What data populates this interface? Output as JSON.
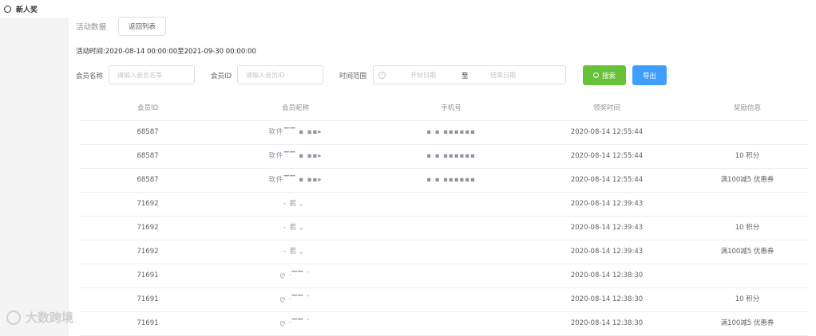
{
  "sidebar": {
    "items": [
      {
        "label": "新人奖"
      }
    ]
  },
  "header": {
    "title": "活动数据",
    "back_label": "返回列表",
    "activity_time": "活动时间:2020-08-14 00:00:00至2021-09-30 00:00:00"
  },
  "filters": {
    "member_name_label": "会员名称",
    "member_name_placeholder": "请输入会员名等",
    "member_id_label": "会员ID",
    "member_id_placeholder": "请输入会员ID",
    "time_range_label": "时间范围",
    "start_placeholder": "开始日期",
    "range_separator": "至",
    "end_placeholder": "结束日期",
    "search_label": "搜索",
    "export_label": "导出"
  },
  "table": {
    "columns": [
      "会员ID",
      "会员昵称",
      "手机号",
      "领奖时间",
      "奖励信息"
    ],
    "rows": [
      {
        "id": "68587",
        "nickname": "软件▔▔ ▪ ▪▪▸",
        "phone": "▪ ▪ ▪▪▪▪▪▪",
        "time": "2020-08-14 12:55:44",
        "reward": ""
      },
      {
        "id": "68587",
        "nickname": "软件▔▔ ▪ ▪▪▸",
        "phone": "▪ ▪ ▪▪▪▪▪▪",
        "time": "2020-08-14 12:55:44",
        "reward": "10 积分"
      },
      {
        "id": "68587",
        "nickname": "软件▔▔ ▪ ▪▪▸",
        "phone": "▪ ▪ ▪▪▪▪▪▪",
        "time": "2020-08-14 12:55:44",
        "reward": "满100减5 优惠券"
      },
      {
        "id": "71692",
        "nickname": "- 若 。",
        "phone": "",
        "time": "2020-08-14 12:39:43",
        "reward": ""
      },
      {
        "id": "71692",
        "nickname": "- 若 。",
        "phone": "",
        "time": "2020-08-14 12:39:43",
        "reward": "10 积分"
      },
      {
        "id": "71692",
        "nickname": "- 若 。",
        "phone": "",
        "time": "2020-08-14 12:39:43",
        "reward": "满100减5 优惠券"
      },
      {
        "id": "71691",
        "nickname": "ღ ·▔▔ ﾞ",
        "phone": "",
        "time": "2020-08-14 12:38:30",
        "reward": ""
      },
      {
        "id": "71691",
        "nickname": "ღ ·▔▔ ﾞ",
        "phone": "",
        "time": "2020-08-14 12:38:30",
        "reward": "10 积分"
      },
      {
        "id": "71691",
        "nickname": "ღ ·▔▔ ﾞ",
        "phone": "",
        "time": "2020-08-14 12:38:30",
        "reward": "满100减5 优惠券"
      }
    ]
  },
  "watermark": {
    "text": "大数跨境"
  },
  "colors": {
    "success": "#67c23a",
    "primary": "#409eff",
    "sidebar_bg": "#f4f4f5"
  },
  "icons": [
    "radio-icon",
    "clock-icon",
    "search-icon",
    "logo-icon"
  ]
}
